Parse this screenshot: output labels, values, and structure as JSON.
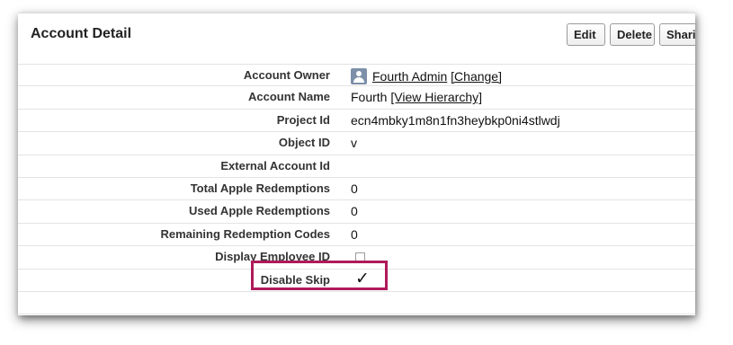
{
  "header": {
    "title": "Account Detail",
    "buttons": {
      "edit": "Edit",
      "delete": "Delete",
      "sharing": "Sharin"
    }
  },
  "fields": {
    "account_owner": {
      "label": "Account Owner",
      "value": "Fourth Admin",
      "change": "[Change]"
    },
    "account_name": {
      "label": "Account Name",
      "value": "Fourth",
      "link": "[View Hierarchy]"
    },
    "project_id": {
      "label": "Project Id",
      "value": "ecn4mbky1m8n1fn3heybkp0ni4stlwdj"
    },
    "object_id": {
      "label": "Object ID",
      "value": "v"
    },
    "external_account_id": {
      "label": "External Account Id",
      "value": ""
    },
    "total_apple_redemptions": {
      "label": "Total Apple Redemptions",
      "value": "0"
    },
    "used_apple_redemptions": {
      "label": "Used Apple Redemptions",
      "value": "0"
    },
    "remaining_redemption_codes": {
      "label": "Remaining Redemption Codes",
      "value": "0"
    },
    "display_employee_id": {
      "label": "Display Employee ID",
      "checked": false
    },
    "disable_skip": {
      "label": "Disable Skip",
      "checked": true,
      "checkmark": "✓"
    }
  },
  "highlight_color": "#b0195a"
}
